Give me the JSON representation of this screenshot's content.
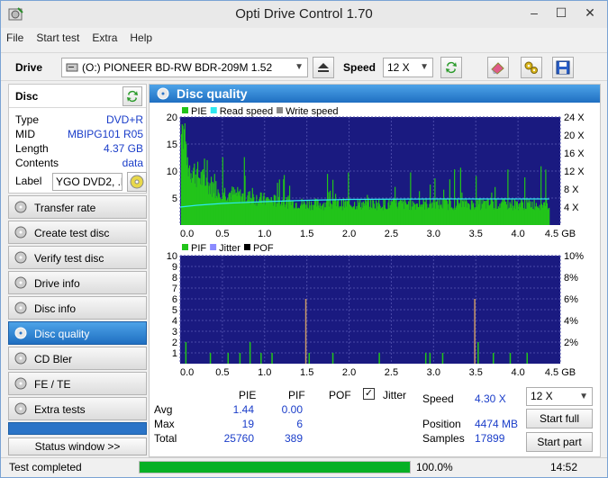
{
  "window": {
    "title": "Opti Drive Control 1.70",
    "controls": [
      "–",
      "☐",
      "✕"
    ]
  },
  "menu": [
    "File",
    "Start test",
    "Extra",
    "Help"
  ],
  "toolbar": {
    "drive_label": "Drive",
    "drive_value": "(O:)  PIONEER BD-RW   BDR-209M 1.52",
    "speed_label": "Speed",
    "speed_value": "12 X"
  },
  "disc": {
    "header": "Disc",
    "type_k": "Type",
    "type_v": "DVD+R",
    "mid_k": "MID",
    "mid_v": "MBIPG101 R05",
    "length_k": "Length",
    "length_v": "4.37 GB",
    "contents_k": "Contents",
    "contents_v": "data",
    "label_k": "Label",
    "label_v": "YGO DVD2, .h"
  },
  "nav": {
    "items": [
      "Transfer rate",
      "Create test disc",
      "Verify test disc",
      "Drive info",
      "Disc info",
      "Disc quality",
      "CD Bler",
      "FE / TE",
      "Extra tests"
    ],
    "active": "Disc quality",
    "status_window": "Status window >>"
  },
  "panel": {
    "title": "Disc quality"
  },
  "colors": {
    "pie": "#22c41a",
    "pif": "#22c41a",
    "read_speed": "#2ee8f0",
    "write_speed": "#888888",
    "jitter": "#8a8aff",
    "pof": "#000000",
    "plot_bg": "#1a1a80",
    "accent": "#2b78c8"
  },
  "chart_data": [
    {
      "type": "bar",
      "legend": [
        "PIE",
        "Read speed",
        "Write speed"
      ],
      "x_ticks": [
        "0.0",
        "0.5",
        "1.0",
        "1.5",
        "2.0",
        "2.5",
        "3.0",
        "3.5",
        "4.0",
        "4.5 GB"
      ],
      "xlim": [
        0,
        4.5
      ],
      "y_ticks": [
        "20",
        "15",
        "10",
        "5"
      ],
      "ylim": [
        0,
        20
      ],
      "y2_ticks": [
        "24 X",
        "20 X",
        "16 X",
        "12 X",
        "8 X",
        "4 X"
      ],
      "y2lim": [
        0,
        24
      ],
      "pie_profile": [
        [
          0.0,
          18
        ],
        [
          0.05,
          16
        ],
        [
          0.1,
          14
        ],
        [
          0.2,
          12
        ],
        [
          0.3,
          10
        ],
        [
          0.4,
          9
        ],
        [
          0.5,
          8
        ],
        [
          0.7,
          7
        ],
        [
          1.0,
          6
        ],
        [
          1.5,
          5
        ],
        [
          2.0,
          5
        ],
        [
          3.0,
          5
        ],
        [
          4.37,
          5
        ]
      ],
      "pie_max": 19,
      "read_speed": [
        [
          0.0,
          4.0
        ],
        [
          0.2,
          4.4
        ],
        [
          0.5,
          4.8
        ],
        [
          1.0,
          5.2
        ],
        [
          1.5,
          5.5
        ],
        [
          2.0,
          5.7
        ],
        [
          3.0,
          5.8
        ],
        [
          4.37,
          5.8
        ]
      ]
    },
    {
      "type": "bar",
      "legend": [
        "PIF",
        "Jitter",
        "POF"
      ],
      "x_ticks": [
        "0.0",
        "0.5",
        "1.0",
        "1.5",
        "2.0",
        "2.5",
        "3.0",
        "3.5",
        "4.0",
        "4.5 GB"
      ],
      "xlim": [
        0,
        4.5
      ],
      "y_ticks": [
        "10",
        "9",
        "8",
        "7",
        "6",
        "5",
        "4",
        "3",
        "2",
        "1"
      ],
      "ylim": [
        0,
        10
      ],
      "y2_ticks": [
        "10%",
        "8%",
        "6%",
        "4%",
        "2%"
      ],
      "y2lim": [
        0,
        10
      ],
      "pif_spikes": [
        [
          0.06,
          2
        ],
        [
          0.35,
          1
        ],
        [
          0.56,
          1
        ],
        [
          0.7,
          1
        ],
        [
          0.82,
          2
        ],
        [
          0.95,
          1
        ],
        [
          1.08,
          1
        ],
        [
          1.48,
          6
        ],
        [
          1.52,
          1
        ],
        [
          1.8,
          1
        ],
        [
          2.35,
          1
        ],
        [
          2.9,
          1
        ],
        [
          2.95,
          1
        ],
        [
          3.1,
          1
        ],
        [
          3.48,
          6
        ],
        [
          3.52,
          2
        ],
        [
          3.7,
          1
        ],
        [
          3.9,
          1
        ],
        [
          4.1,
          1
        ]
      ]
    }
  ],
  "stats": {
    "col_pie": "PIE",
    "col_pif": "PIF",
    "col_pof": "POF",
    "col_jitter": "Jitter",
    "row_avg": "Avg",
    "row_max": "Max",
    "row_total": "Total",
    "avg_pie": "1.44",
    "avg_pif": "0.00",
    "max_pie": "19",
    "max_pif": "6",
    "total_pie": "25760",
    "total_pif": "389",
    "speed_k": "Speed",
    "speed_v": "4.30 X",
    "position_k": "Position",
    "position_v": "4474 MB",
    "samples_k": "Samples",
    "samples_v": "17899",
    "speed_combo": "12 X",
    "start_full": "Start full",
    "start_part": "Start part",
    "jitter_checked": true
  },
  "status": {
    "text": "Test completed",
    "progress": 1.0,
    "progress_text": "100.0%",
    "time": "14:52"
  }
}
